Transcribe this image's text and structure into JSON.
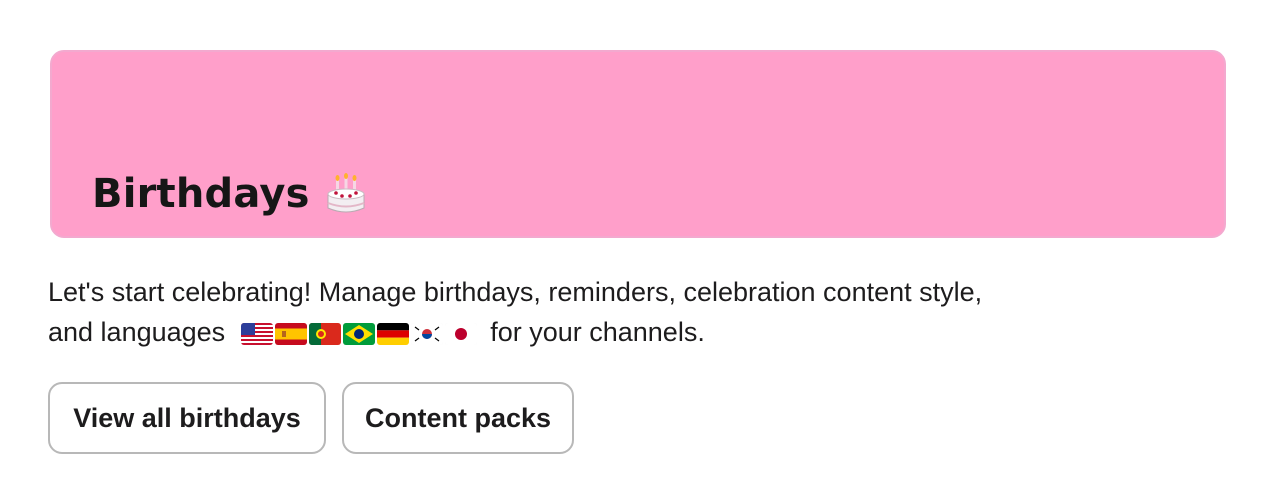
{
  "banner": {
    "title": "Birthdays",
    "emoji_icon": "birthday-cake-icon",
    "background_color": "#ff9fca"
  },
  "description": {
    "line1": "Let's start celebrating! Manage birthdays, reminders, celebration content style,",
    "line2_prefix": "and languages",
    "line2_suffix": "for your channels.",
    "flags": [
      "us-flag-icon",
      "spain-flag-icon",
      "portugal-flag-icon",
      "brazil-flag-icon",
      "germany-flag-icon",
      "south-korea-flag-icon",
      "japan-flag-icon"
    ]
  },
  "buttons": {
    "view_all_label": "View all birthdays",
    "content_packs_label": "Content packs"
  }
}
